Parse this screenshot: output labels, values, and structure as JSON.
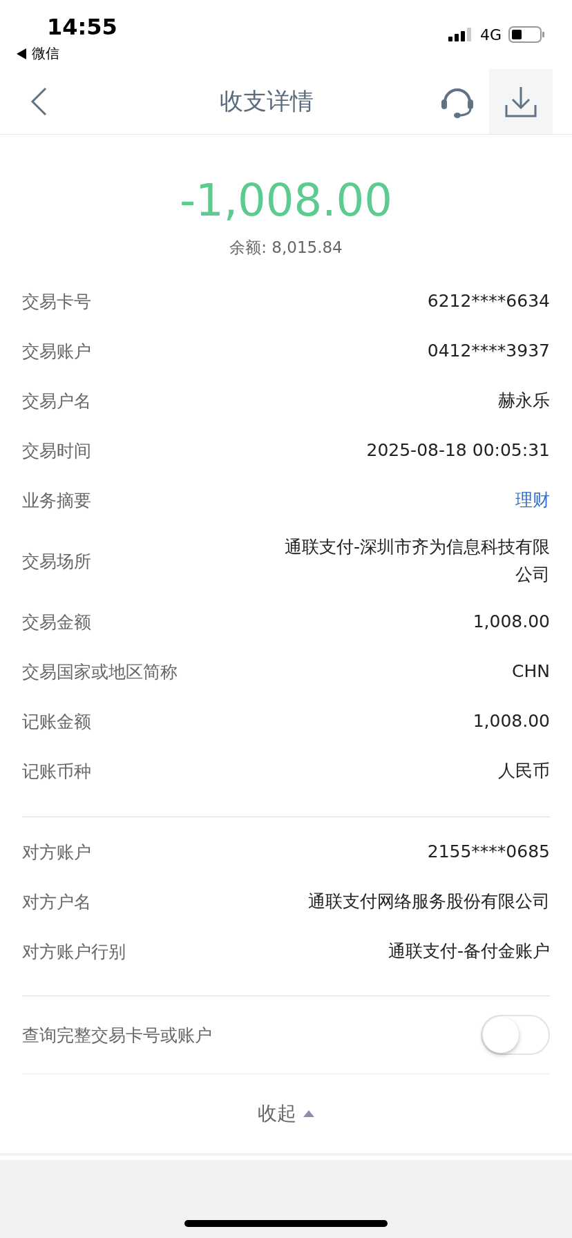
{
  "status_bar": {
    "time": "14:55",
    "back_app": "微信",
    "network": "4G"
  },
  "nav": {
    "title": "收支详情"
  },
  "summary": {
    "amount": "-1,008.00",
    "balance": "余额: 8,015.84"
  },
  "sections": [
    [
      {
        "label": "交易卡号",
        "value": "6212****6634",
        "kind": "text"
      },
      {
        "label": "交易账户",
        "value": "0412****3937",
        "kind": "text"
      },
      {
        "label": "交易户名",
        "value": "赫永乐",
        "kind": "text"
      },
      {
        "label": "交易时间",
        "value": "2025-08-18 00:05:31",
        "kind": "text"
      },
      {
        "label": "业务摘要",
        "value": "理财",
        "kind": "link"
      },
      {
        "label": "交易场所",
        "value": "通联支付-深圳市齐为信息科技有限公司",
        "kind": "text"
      },
      {
        "label": "交易金额",
        "value": "1,008.00",
        "kind": "text"
      },
      {
        "label": "交易国家或地区简称",
        "value": "CHN",
        "kind": "text"
      },
      {
        "label": "记账金额",
        "value": "1,008.00",
        "kind": "text"
      },
      {
        "label": "记账币种",
        "value": "人民币",
        "kind": "text"
      }
    ],
    [
      {
        "label": "对方账户",
        "value": "2155****0685",
        "kind": "text"
      },
      {
        "label": "对方户名",
        "value": "通联支付网络服务股份有限公司",
        "kind": "text"
      },
      {
        "label": "对方账户行别",
        "value": "通联支付-备付金账户",
        "kind": "text"
      }
    ]
  ],
  "query_toggle": {
    "label": "查询完整交易卡号或账户",
    "on": false
  },
  "collapse": {
    "label": "收起"
  }
}
